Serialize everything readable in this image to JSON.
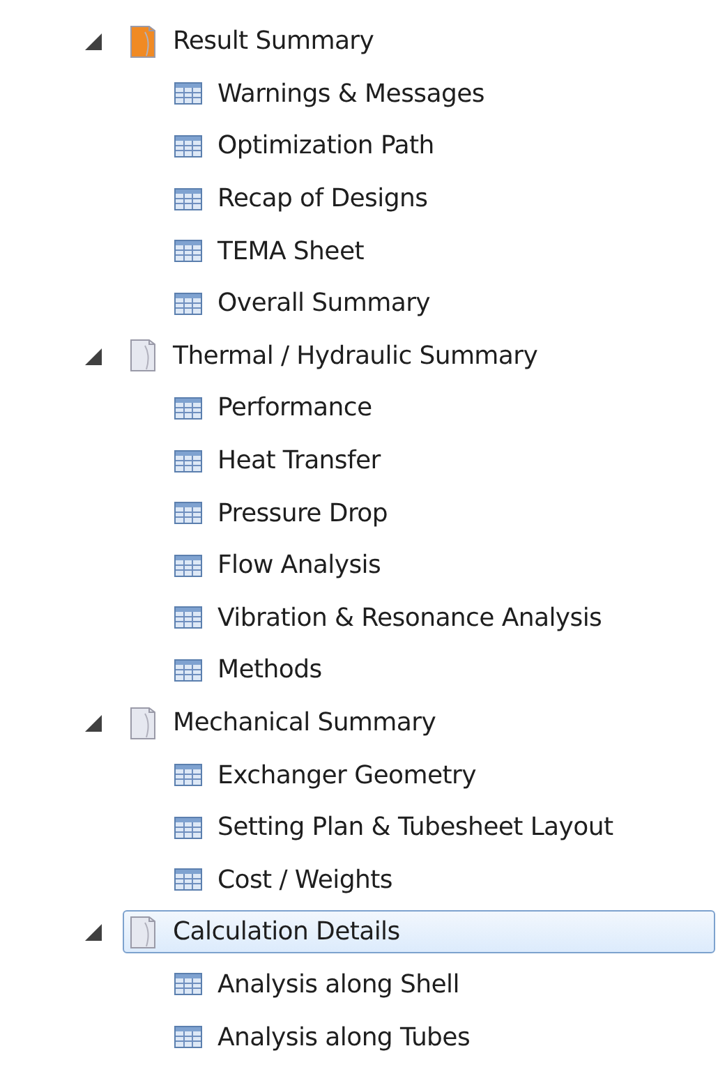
{
  "tree": [
    {
      "label": "Result Summary",
      "expanded": true,
      "selected": false,
      "color": "#f08a24",
      "children": [
        {
          "label": "Warnings & Messages"
        },
        {
          "label": "Optimization Path"
        },
        {
          "label": "Recap of Designs"
        },
        {
          "label": "TEMA Sheet"
        },
        {
          "label": "Overall Summary"
        }
      ]
    },
    {
      "label": "Thermal / Hydraulic Summary",
      "expanded": true,
      "selected": false,
      "color": "#e6e8f0",
      "children": [
        {
          "label": "Performance"
        },
        {
          "label": "Heat Transfer"
        },
        {
          "label": "Pressure Drop"
        },
        {
          "label": "Flow Analysis"
        },
        {
          "label": "Vibration & Resonance Analysis"
        },
        {
          "label": "Methods"
        }
      ]
    },
    {
      "label": "Mechanical Summary",
      "expanded": true,
      "selected": false,
      "color": "#e6e8f0",
      "children": [
        {
          "label": "Exchanger Geometry"
        },
        {
          "label": "Setting Plan & Tubesheet Layout"
        },
        {
          "label": "Cost / Weights"
        }
      ]
    },
    {
      "label": "Calculation Details",
      "expanded": true,
      "selected": true,
      "color": "#e6e8f0",
      "children": [
        {
          "label": "Analysis along Shell"
        },
        {
          "label": "Analysis along Tubes"
        }
      ]
    }
  ]
}
